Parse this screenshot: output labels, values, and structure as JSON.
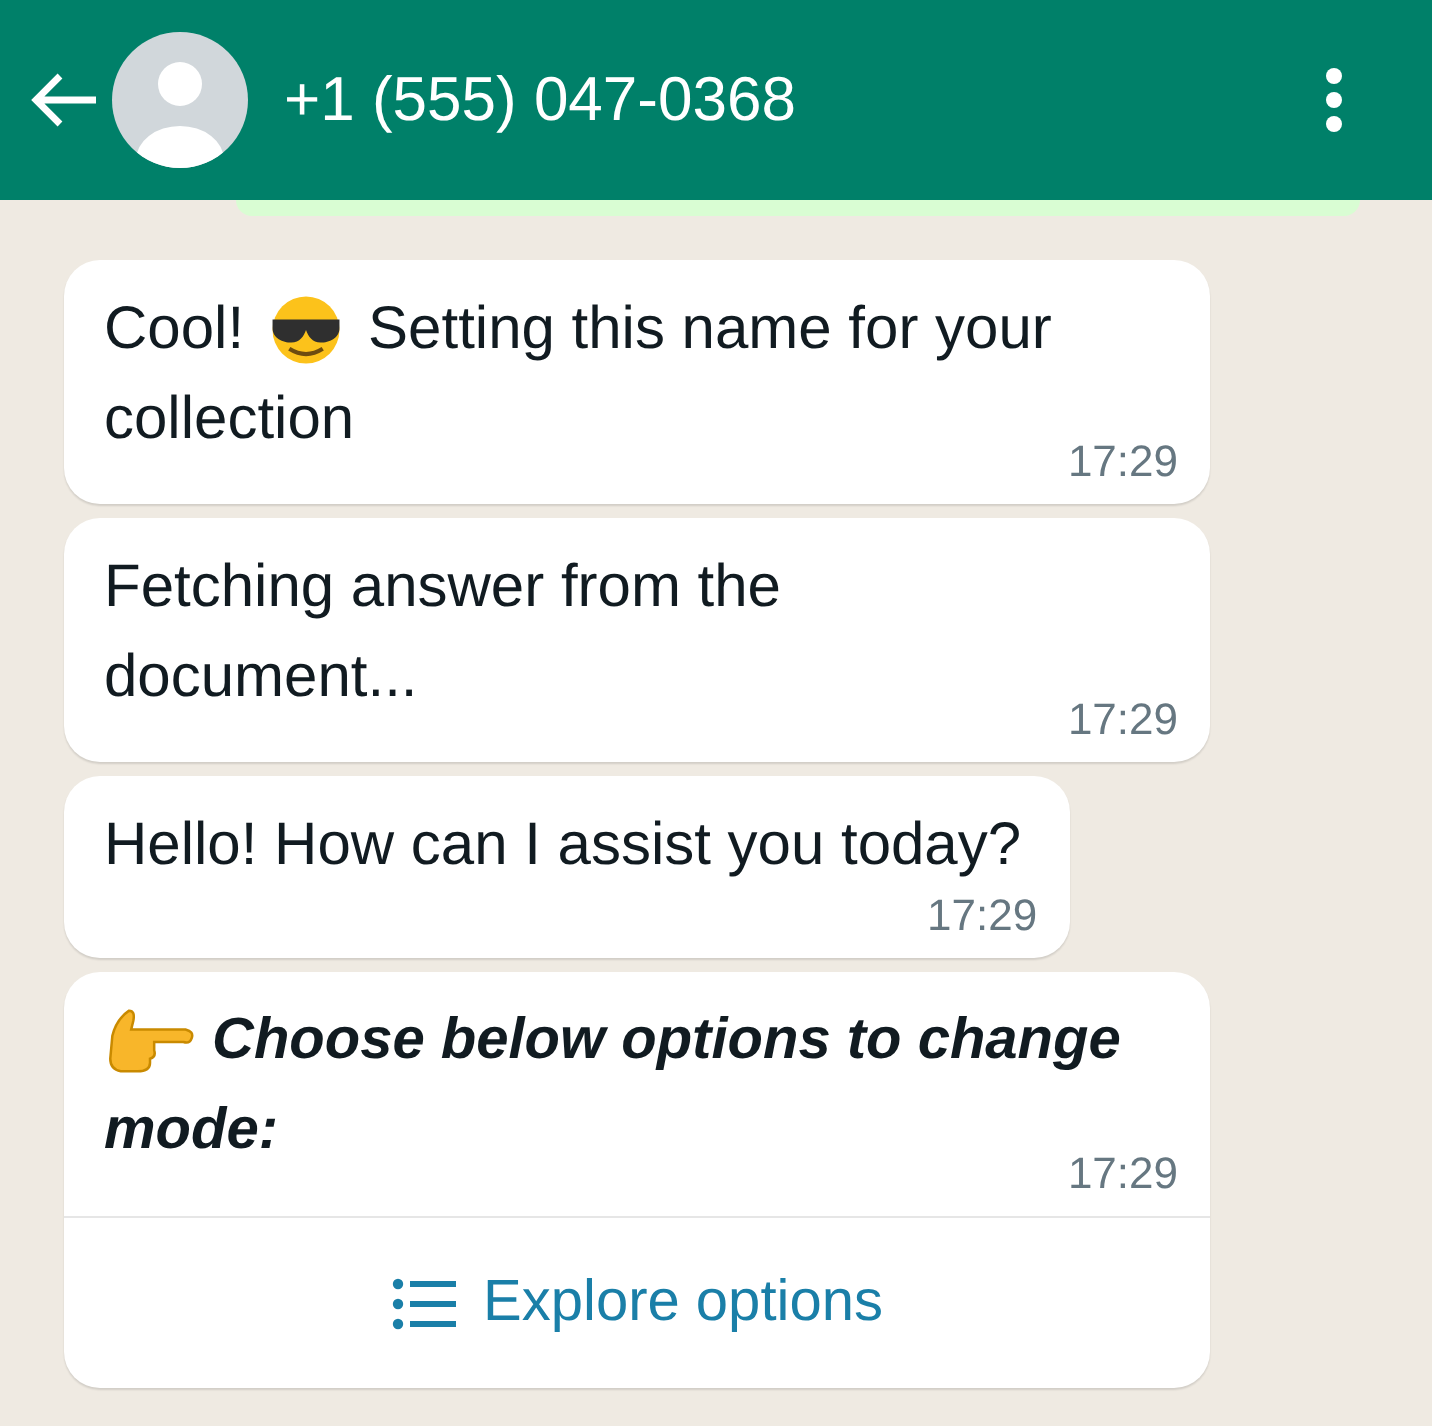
{
  "header": {
    "title": "+1 (555) 047-0368"
  },
  "messages": [
    {
      "lines": [
        [
          {
            "kind": "text",
            "text": "Cool!"
          },
          {
            "kind": "sunglasses"
          },
          {
            "kind": "text",
            "text": "Setting this name for your"
          }
        ],
        [
          {
            "kind": "text",
            "text": "collection"
          }
        ]
      ],
      "time": "17:29",
      "emphasis": false
    },
    {
      "lines": [
        [
          {
            "kind": "text",
            "text": "Fetching answer from the"
          }
        ],
        [
          {
            "kind": "text",
            "text": "document..."
          }
        ]
      ],
      "time": "17:29",
      "emphasis": false
    },
    {
      "lines": [
        [
          {
            "kind": "text",
            "text": "Hello! How can I assist you today?"
          }
        ]
      ],
      "time": "17:29",
      "emphasis": false
    },
    {
      "lines": [
        [
          {
            "kind": "pointing"
          },
          {
            "kind": "text",
            "text": "Choose below options to change"
          }
        ],
        [
          {
            "kind": "text",
            "text": "mode:"
          }
        ]
      ],
      "time": "17:29",
      "emphasis": true,
      "action": {
        "label": "Explore options"
      }
    }
  ]
}
